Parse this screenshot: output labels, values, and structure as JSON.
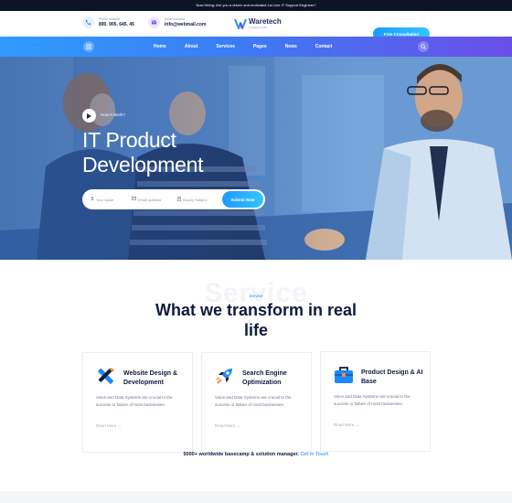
{
  "announcement": "Now Hiring: Are you a driven and motivated 1st Line IT Support Engineer?",
  "header": {
    "phone_label": "Phone Number",
    "phone_value": "890. 905. 645. 45",
    "email_label": "Email Address",
    "email_value": "info@webmail.com",
    "logo_name": "Waretech",
    "logo_tagline": "IT Agency LTD.",
    "cta_label": "Free Consultation"
  },
  "nav": {
    "items": [
      {
        "label": "Home"
      },
      {
        "label": "About"
      },
      {
        "label": "Services"
      },
      {
        "label": "Pages"
      },
      {
        "label": "News"
      },
      {
        "label": "Contact"
      }
    ]
  },
  "hero": {
    "play_label": "How It Work?",
    "title_line1": "IT Product",
    "title_line2": "Development",
    "form": {
      "name_placeholder": "Your name",
      "email_placeholder": "Email address",
      "subject_placeholder": "Inquiry Subject",
      "submit_label": "Submit Now"
    }
  },
  "services": {
    "background_word": "Service",
    "tag": "Service",
    "title": "What we transform in real life",
    "cards": [
      {
        "title": "Website Design & Development",
        "description": "Voice and Data Systems are crucial to the success or failure of most businesses.",
        "link": "Read More",
        "icon": "pencil-ruler-icon"
      },
      {
        "title": "Search Engine Optimization",
        "description": "Voice and Data Systems are crucial to the success or failure of most businesses.",
        "link": "Read More",
        "icon": "rocket-icon"
      },
      {
        "title": "Product Design & AI Base",
        "description": "Voice and Data Systems are crucial to the success or failure of most businesses.",
        "link": "Read More",
        "icon": "briefcase-icon"
      }
    ],
    "bottom_text": "5000+ worldwide basecamp & solution manager.",
    "bottom_link": "Get In Touch"
  },
  "colors": {
    "accent": "#1e88ff",
    "nav_gradient_start": "#2f9bff",
    "nav_gradient_end": "#6b4ee8",
    "dark_text": "#0f1b3d"
  }
}
